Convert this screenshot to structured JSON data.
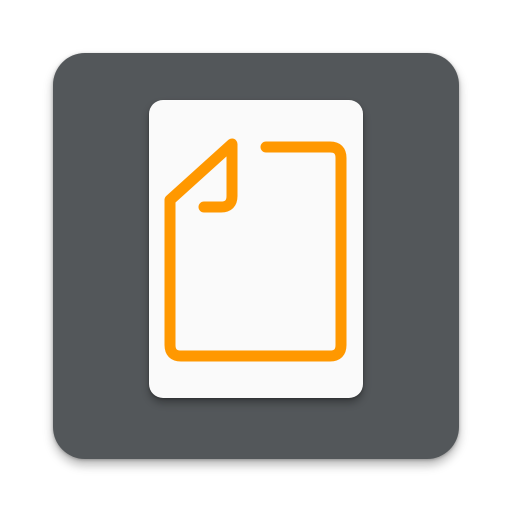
{
  "app_icon": {
    "icon": "document-icon",
    "colors": {
      "tile_background": "#53575A",
      "card_background": "#FAFAFA",
      "accent": "#FF9800"
    }
  }
}
